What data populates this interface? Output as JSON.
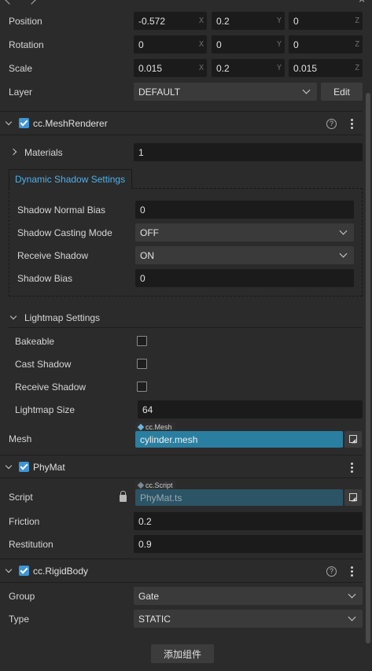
{
  "transform": {
    "position": {
      "label": "Position",
      "x": "-0.572",
      "y": "0.2",
      "z": "0"
    },
    "rotation": {
      "label": "Rotation",
      "x": "0",
      "y": "0",
      "z": "0"
    },
    "scale": {
      "label": "Scale",
      "x": "0.015",
      "y": "0.2",
      "z": "0.015"
    },
    "axes": {
      "x": "X",
      "y": "Y",
      "z": "Z"
    },
    "layer": {
      "label": "Layer",
      "value": "DEFAULT",
      "edit_label": "Edit"
    }
  },
  "mesh_renderer": {
    "title": "cc.MeshRenderer",
    "help_symbol": "?",
    "materials": {
      "label": "Materials",
      "value": "1"
    },
    "dynamic_shadow": {
      "tab_label": "Dynamic Shadow Settings",
      "normal_bias": {
        "label": "Shadow Normal Bias",
        "value": "0"
      },
      "casting_mode": {
        "label": "Shadow Casting Mode",
        "value": "OFF"
      },
      "receive_shadow": {
        "label": "Receive Shadow",
        "value": "ON"
      },
      "bias": {
        "label": "Shadow Bias",
        "value": "0"
      }
    },
    "lightmap": {
      "title": "Lightmap Settings",
      "bakeable": {
        "label": "Bakeable",
        "checked": false
      },
      "cast_shadow": {
        "label": "Cast Shadow",
        "checked": false
      },
      "receive_shadow": {
        "label": "Receive Shadow",
        "checked": false
      },
      "size": {
        "label": "Lightmap Size",
        "value": "64"
      }
    },
    "mesh": {
      "label": "Mesh",
      "type_tag": "cc.Mesh",
      "value": "cylinder.mesh"
    }
  },
  "phymat": {
    "title": "PhyMat",
    "script": {
      "label": "Script",
      "type_tag": "cc.Script",
      "value": "PhyMat.ts"
    },
    "friction": {
      "label": "Friction",
      "value": "0.2"
    },
    "restitution": {
      "label": "Restitution",
      "value": "0.9"
    }
  },
  "rigidbody": {
    "title": "cc.RigidBody",
    "help_symbol": "?",
    "group": {
      "label": "Group",
      "value": "Gate"
    },
    "type": {
      "label": "Type",
      "value": "STATIC"
    }
  },
  "add_component_label": "添加组件",
  "colors": {
    "accent": "#3e96d6",
    "asset_field": "#2a7fa0",
    "tab_text": "#4fb0e8"
  }
}
